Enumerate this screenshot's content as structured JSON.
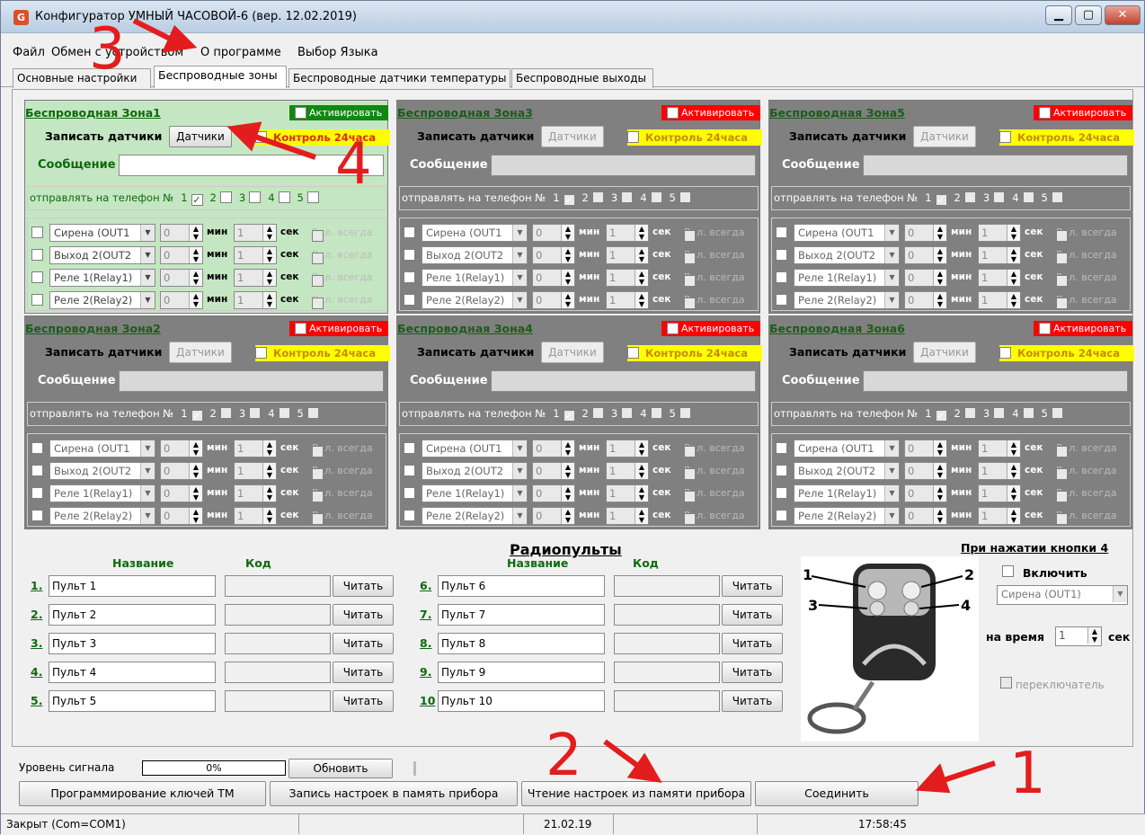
{
  "window": {
    "title": "Конфигуратор УМНЫЙ ЧАСОВОЙ-6 (вер. 12.02.2019)",
    "icon_letter": "G"
  },
  "menu": [
    "Файл",
    "Обмен с устройством",
    "О программе",
    "Выбор Языка"
  ],
  "tabs": [
    "Основные настройки",
    "Беспроводные зоны",
    "Беспроводные датчики температуры",
    "Беспроводные выходы"
  ],
  "active_tab": 1,
  "zone_labels": {
    "activate": "Активировать",
    "write_sensors": "Записать датчики",
    "sensors_btn": "Датчики",
    "control24": "Контроль 24часа",
    "message": "Сообщение",
    "send_phone": "отправлять на телефон №",
    "min": "мин",
    "sec": "сек",
    "always_on": "Вкл. всегда"
  },
  "zones": [
    {
      "title": "Беспроводная Зона1",
      "active": true,
      "activated": true,
      "phones": [
        true,
        false,
        false,
        false,
        false
      ]
    },
    {
      "title": "Беспроводная Зона2",
      "active": false,
      "activated": false,
      "phones": [
        true,
        false,
        false,
        false,
        false
      ]
    },
    {
      "title": "Беспроводная Зона3",
      "active": false,
      "activated": false,
      "phones": [
        true,
        false,
        false,
        false,
        false
      ]
    },
    {
      "title": "Беспроводная Зона4",
      "active": false,
      "activated": false,
      "phones": [
        true,
        false,
        false,
        false,
        false
      ]
    },
    {
      "title": "Беспроводная Зона5",
      "active": false,
      "activated": false,
      "phones": [
        true,
        false,
        false,
        false,
        false
      ]
    },
    {
      "title": "Беспроводная Зона6",
      "active": false,
      "activated": false,
      "phones": [
        true,
        false,
        false,
        false,
        false
      ]
    }
  ],
  "outputs": [
    {
      "name": "Сирена (OUT1",
      "min": "0",
      "sec": "1"
    },
    {
      "name": "Выход 2(OUT2",
      "min": "0",
      "sec": "1"
    },
    {
      "name": "Реле 1(Relay1)",
      "min": "0",
      "sec": "1"
    },
    {
      "name": "Реле 2(Relay2)",
      "min": "0",
      "sec": "1"
    }
  ],
  "radio": {
    "title": "Радиопульты",
    "col_name": "Название",
    "col_code": "Код",
    "read_btn": "Читать",
    "remotes": [
      {
        "num": "1.",
        "name": "Пульт 1"
      },
      {
        "num": "2.",
        "name": "Пульт 2"
      },
      {
        "num": "3.",
        "name": "Пульт 3"
      },
      {
        "num": "4.",
        "name": "Пульт 4"
      },
      {
        "num": "5.",
        "name": "Пульт 5"
      },
      {
        "num": "6.",
        "name": "Пульт 6"
      },
      {
        "num": "7.",
        "name": "Пульт 7"
      },
      {
        "num": "8.",
        "name": "Пульт 8"
      },
      {
        "num": "9.",
        "name": "Пульт 9"
      },
      {
        "num": "10",
        "name": "Пульт 10"
      }
    ]
  },
  "button4": {
    "title": "При нажатии кнопки 4",
    "enable": "Включить",
    "output": "Сирена (OUT1)",
    "time_label": "на время",
    "time_value": "1",
    "time_unit": "сек",
    "toggle": "переключатель",
    "fob_labels": [
      "1",
      "2",
      "3",
      "4"
    ]
  },
  "signal": {
    "label": "Уровень сигнала",
    "value": "0%",
    "refresh": "Обновить"
  },
  "buttons": {
    "tm": "Программирование ключей ТМ",
    "write": "Запись настроек в память прибора",
    "read": "Чтение настроек из памяти прибора",
    "connect": "Соединить"
  },
  "statusbar": {
    "port": "Закрыт (Com=COM1)",
    "date": "21.02.19",
    "time": "17:58:45"
  },
  "annotations": [
    "1",
    "2",
    "3",
    "4"
  ],
  "colors": {
    "active_zone": "#c5e6c2",
    "inactive_zone": "#808080",
    "activate_on": "#118811",
    "activate_off": "#ff0000",
    "control24": "#ffff00",
    "annotation": "#e31d1d"
  }
}
